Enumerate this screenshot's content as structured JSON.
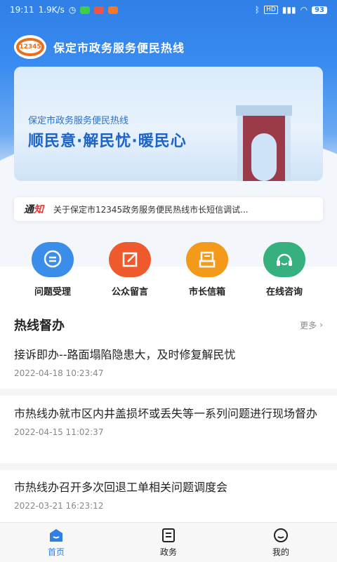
{
  "status_bar": {
    "time": "19:11",
    "speed": "1.9K/s",
    "battery": "93"
  },
  "app": {
    "title": "保定市政务服务便民热线",
    "logo_text": "12345"
  },
  "banner": {
    "subtitle": "保定市政务服务便民热线",
    "slogan": "顺民意·解民忧·暖民心"
  },
  "notice": {
    "tag_a": "通",
    "tag_b": "知",
    "text": "关于保定市12345政务服务便民热线市长短信调试..."
  },
  "quick_actions": [
    {
      "label": "问题受理",
      "color": "#3a8ee9",
      "icon": "chat-bubble-icon"
    },
    {
      "label": "公众留言",
      "color": "#ee5a2b",
      "icon": "edit-icon"
    },
    {
      "label": "市长信箱",
      "color": "#f39a1b",
      "icon": "mailbox-icon"
    },
    {
      "label": "在线咨询",
      "color": "#35b07e",
      "icon": "headset-icon"
    }
  ],
  "section": {
    "title": "热线督办",
    "more": "更多"
  },
  "news": [
    {
      "title": "接诉即办--路面塌陷隐患大，及时修复解民忧",
      "date": "2022-04-18 10:23:47"
    },
    {
      "title": "市热线办就市区内井盖损坏或丢失等一系列问题进行现场督办",
      "date": "2022-04-15 11:02:37"
    },
    {
      "title": "市热线办召开多次回退工单相关问题调度会",
      "date": "2022-03-21 16:23:12"
    }
  ],
  "tabs": [
    {
      "label": "首页",
      "icon": "home-icon",
      "active": true
    },
    {
      "label": "政务",
      "icon": "document-icon",
      "active": false
    },
    {
      "label": "我的",
      "icon": "smile-icon",
      "active": false
    }
  ],
  "colors": {
    "primary": "#2f7fe6",
    "accent_red": "#e33"
  }
}
